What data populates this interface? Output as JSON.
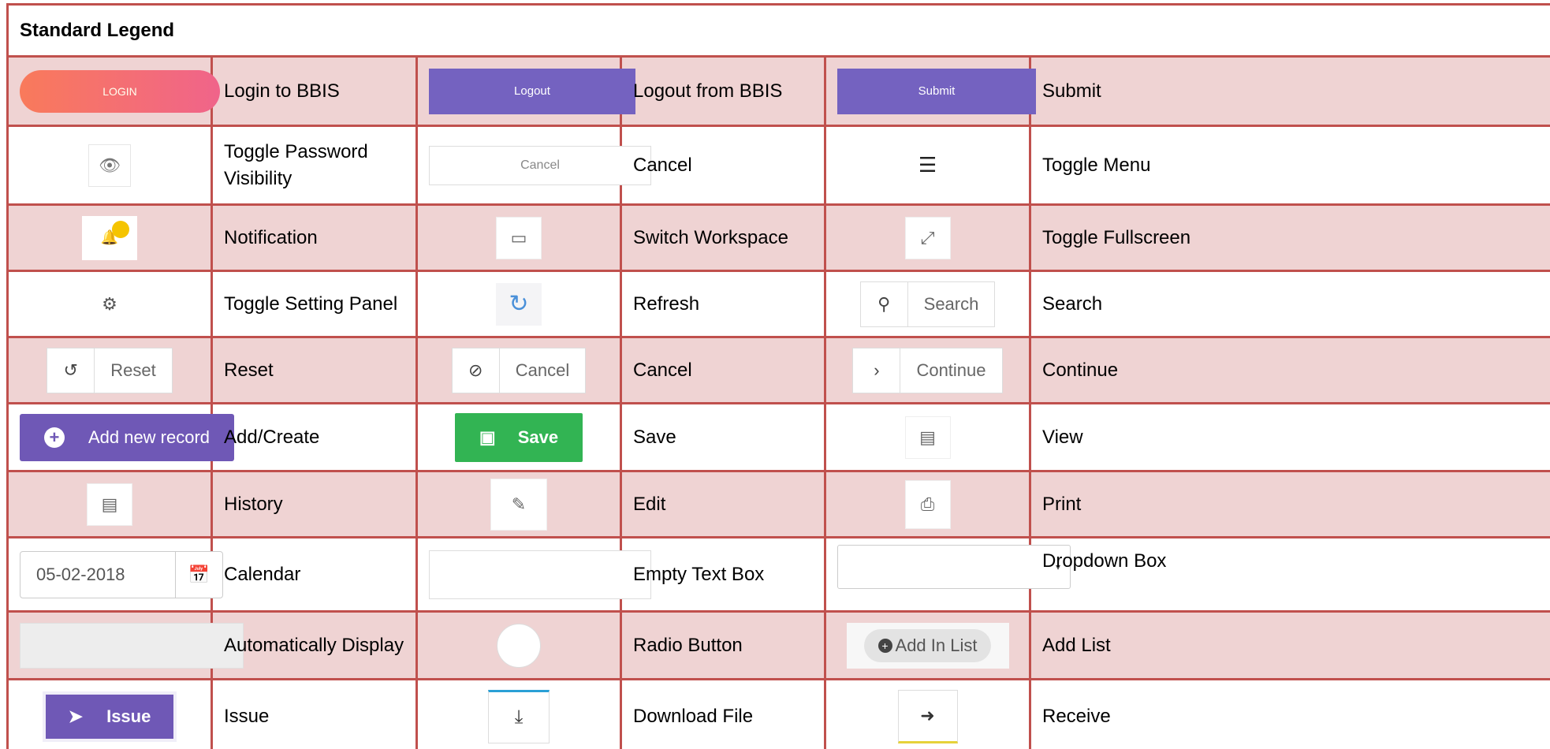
{
  "header": {
    "title": "Standard Legend"
  },
  "rows": [
    [
      {
        "control": "LOGIN",
        "label": "Login to BBIS"
      },
      {
        "control": "Logout",
        "label": "Logout from BBIS"
      },
      {
        "control": "Submit",
        "label": "Submit"
      }
    ],
    [
      {
        "control": "eye-icon",
        "label": "Toggle Password Visibility"
      },
      {
        "control": "Cancel",
        "label": "Cancel"
      },
      {
        "control": "menu-toggle-icon",
        "label": "Toggle Menu"
      }
    ],
    [
      {
        "control": "bell-icon",
        "label": "Notification"
      },
      {
        "control": "monitor-icon",
        "label": "Switch Workspace"
      },
      {
        "control": "expand-icon",
        "label": "Toggle Fullscreen"
      }
    ],
    [
      {
        "control": "gear-icon",
        "label": "Toggle Setting Panel"
      },
      {
        "control": "refresh-icon",
        "label": "Refresh"
      },
      {
        "control": "Search",
        "label": "Search"
      }
    ],
    [
      {
        "control": "Reset",
        "label": "Reset"
      },
      {
        "control": "Cancel",
        "label": "Cancel"
      },
      {
        "control": "Continue",
        "label": "Continue"
      }
    ],
    [
      {
        "control": "Add new record",
        "label": "Add/Create"
      },
      {
        "control": "Save",
        "label": "Save"
      },
      {
        "control": "view-icon",
        "label": "View"
      }
    ],
    [
      {
        "control": "history-icon",
        "label": "History"
      },
      {
        "control": "pencil-icon",
        "label": "Edit"
      },
      {
        "control": "printer-icon",
        "label": "Print"
      }
    ],
    [
      {
        "control": "05-02-2018",
        "label": "Calendar"
      },
      {
        "control": "",
        "label": "Empty Text Box"
      },
      {
        "control": "",
        "label": "Dropdown Box"
      }
    ],
    [
      {
        "control": "",
        "label": "Automatically Display"
      },
      {
        "control": "",
        "label": "Radio Button"
      },
      {
        "control": "Add In List",
        "label": "Add List"
      }
    ],
    [
      {
        "control": "Issue",
        "label": "Issue"
      },
      {
        "control": "download-icon",
        "label": "Download File"
      },
      {
        "control": "sign-in-icon",
        "label": "Receive"
      }
    ]
  ],
  "colors": {
    "border": "#c0504d",
    "pink_row": "#efd3d3",
    "purple_button": "#7462c0",
    "green_button": "#32b453"
  }
}
